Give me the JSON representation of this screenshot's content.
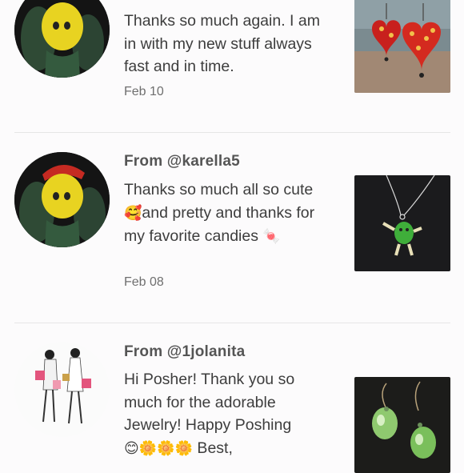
{
  "reviews": [
    {
      "from": "",
      "message": "Thanks so much again. I am in with my new stuff always fast and in time.",
      "date": "Feb 10",
      "avatar_icon": "mm-yellow-character-avatar",
      "thumb_icon": "red-heart-earrings-photo"
    },
    {
      "from": "From @karella5",
      "message_parts": [
        "Thanks so much all so cute ",
        "🥰",
        "and pretty and thanks for my favorite candies ",
        "🍬"
      ],
      "date": "Feb 08",
      "avatar_icon": "mm-yellow-character-avatar",
      "thumb_icon": "mm-pendant-necklace-photo"
    },
    {
      "from": "From @1jolanita",
      "message_parts": [
        "Hi Posher! Thank you so much for the adorable Jewelry! Happy Poshing",
        "😊🌼🌼🌼",
        " Best,"
      ],
      "avatar_icon": "two-fashion-girls-avatar",
      "thumb_icon": "green-drop-earrings-photo"
    }
  ],
  "colors": {
    "background": "#fcfbfc",
    "text": "#3d3d3d",
    "divider": "#e6e6e6"
  }
}
